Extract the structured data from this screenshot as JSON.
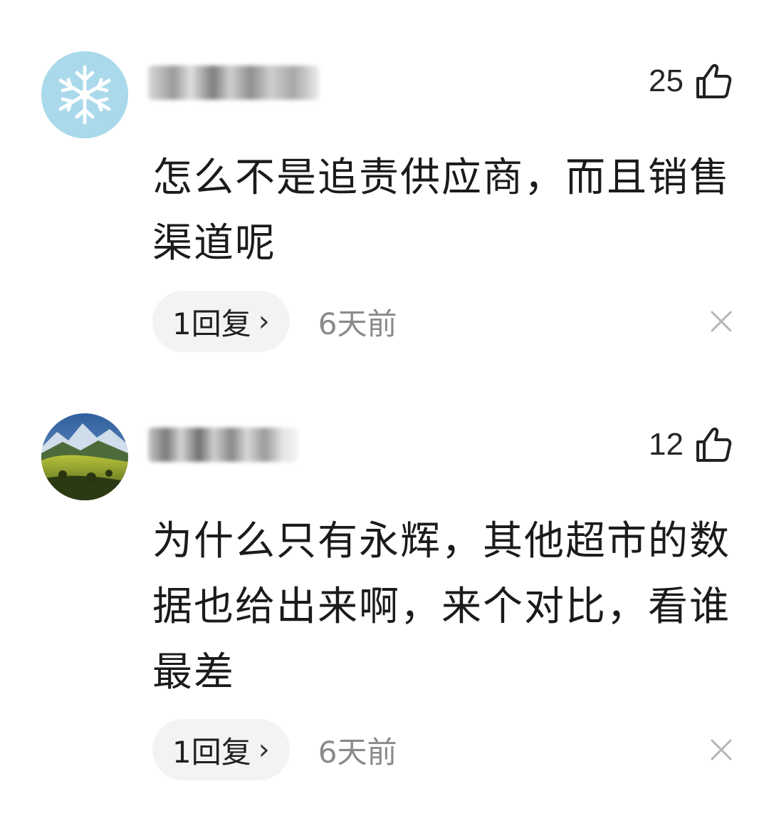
{
  "comments": [
    {
      "avatar": "snowflake-avatar",
      "likes": "25",
      "text": "怎么不是追责供应商，而且销售渠道呢",
      "reply_count": "1回复",
      "reply_chevron": "›",
      "time": "6天前",
      "close_label": "✕"
    },
    {
      "avatar": "landscape-avatar",
      "likes": "12",
      "text": "为什么只有永辉，其他超市的数据也给出来啊，来个对比，看谁最差",
      "reply_count": "1回复",
      "reply_chevron": "›",
      "time": "6天前",
      "close_label": "✕"
    }
  ],
  "icons": {
    "like": "thumbs-up-icon",
    "close": "close-icon"
  },
  "colors": {
    "text": "#1b1b1b",
    "muted": "#8a8a8a",
    "pill_bg": "#f3f3f3",
    "snowflake_bg": "#a8d8ea"
  }
}
